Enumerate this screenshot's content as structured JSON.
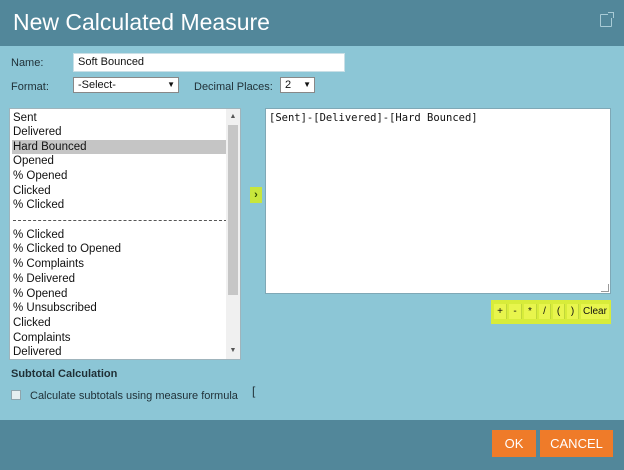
{
  "dialog": {
    "title": "New Calculated Measure"
  },
  "form": {
    "name_label": "Name:",
    "name_value": "Soft Bounced",
    "format_label": "Format:",
    "format_value": "-Select-",
    "decimal_label": "Decimal Places:",
    "decimal_value": "2"
  },
  "measure_list": {
    "items": [
      "Sent",
      "Delivered",
      "Hard Bounced",
      "Opened",
      "% Opened",
      "Clicked",
      "% Clicked"
    ],
    "separator": "------------------------------------------------",
    "items_after": [
      "% Clicked",
      "% Clicked to Opened",
      "% Complaints",
      "% Delivered",
      "% Opened",
      "% Unsubscribed",
      "Clicked",
      "Complaints",
      "Delivered"
    ],
    "selected": "Hard Bounced"
  },
  "formula": {
    "text": "[Sent]-[Delivered]-[Hard Bounced]"
  },
  "operators": {
    "plus": "+",
    "minus": "-",
    "times": "*",
    "divide": "/",
    "open": "(",
    "close": ")",
    "clear": "Clear"
  },
  "subtotal": {
    "heading": "Subtotal Calculation",
    "checkbox_label": "Calculate subtotals using measure formula",
    "bracket": "["
  },
  "buttons": {
    "ok": "OK",
    "cancel": "CANCEL"
  },
  "colors": {
    "title_bar": "#52879a",
    "body": "#8cc6d6",
    "accent_orange": "#ef7b29",
    "accent_green": "#d8ec3a"
  }
}
